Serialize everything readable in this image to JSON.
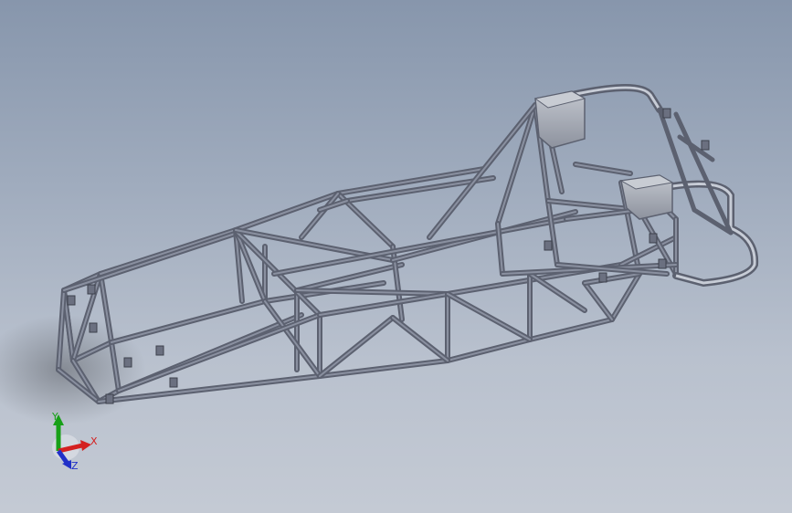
{
  "viewport": {
    "model_name": "",
    "background_top": "#8796ac",
    "background_bottom": "#c4cad4"
  },
  "triad": {
    "x_label": "X",
    "y_label": "Y",
    "z_label": "Z",
    "x_color": "#d42020",
    "y_color": "#18a018",
    "z_color": "#2030c8"
  },
  "frame": {
    "tube_color": "#5c6170",
    "tube_highlight": "#8a90a0",
    "box_color": "#9aa0ac"
  }
}
